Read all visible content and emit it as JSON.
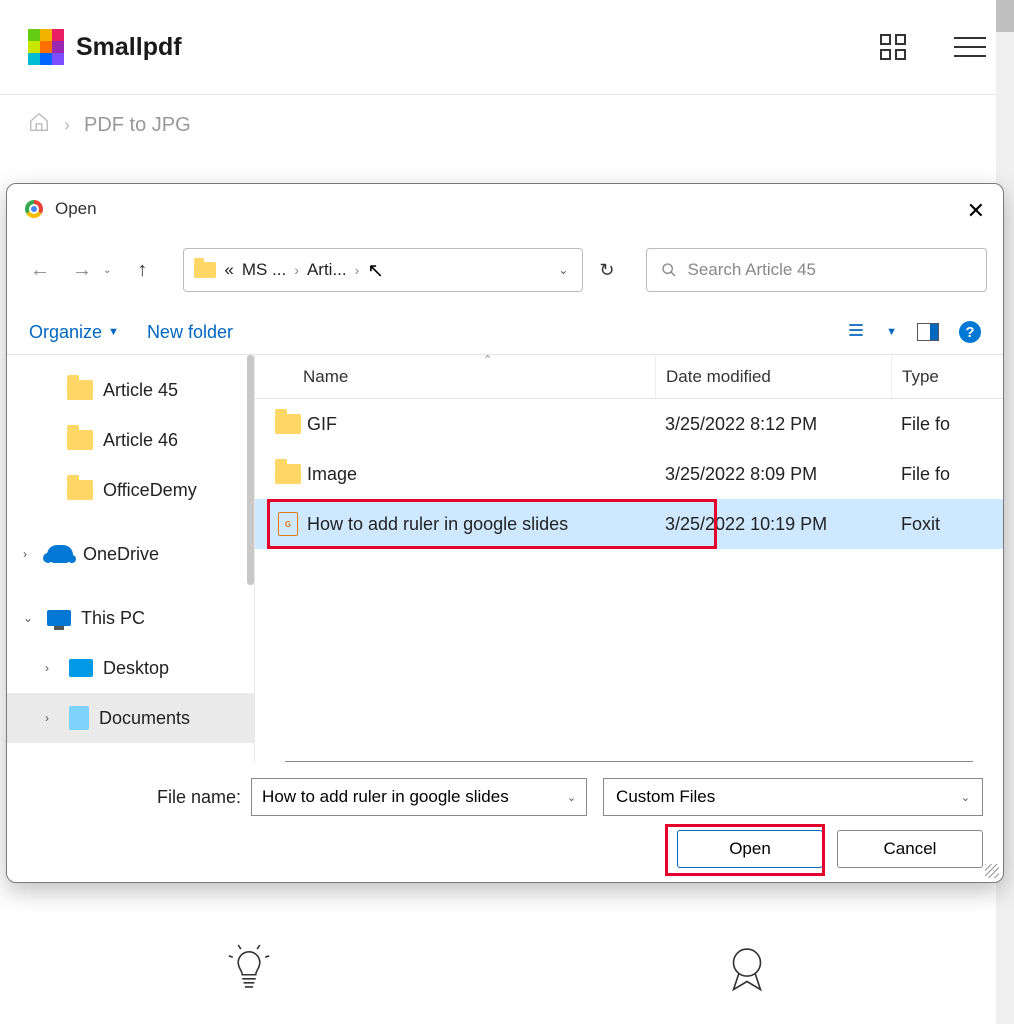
{
  "app": {
    "brand": "Smallpdf"
  },
  "breadcrumb": {
    "page": "PDF to JPG"
  },
  "dialog": {
    "title": "Open",
    "address": {
      "prefix": "«",
      "part1": "MS ...",
      "part2": "Arti..."
    },
    "search_placeholder": "Search Article 45",
    "toolbar": {
      "organize": "Organize",
      "new_folder": "New folder"
    },
    "tree": [
      {
        "label": "Article 45"
      },
      {
        "label": "Article 46"
      },
      {
        "label": "OfficeDemy"
      },
      {
        "label": "OneDrive"
      },
      {
        "label": "This PC"
      },
      {
        "label": "Desktop"
      },
      {
        "label": "Documents"
      }
    ],
    "columns": {
      "name": "Name",
      "date": "Date modified",
      "type": "Type"
    },
    "files": [
      {
        "name": "GIF",
        "date": "3/25/2022 8:12 PM",
        "type": "File fo",
        "kind": "folder"
      },
      {
        "name": "Image",
        "date": "3/25/2022 8:09 PM",
        "type": "File fo",
        "kind": "folder"
      },
      {
        "name": "How to add ruler in google slides",
        "date": "3/25/2022 10:19 PM",
        "type": "Foxit",
        "kind": "pdf",
        "selected": true
      }
    ],
    "filename_label": "File name:",
    "filename_value": "How to add ruler in google slides",
    "filter": "Custom Files",
    "open_btn": "Open",
    "cancel_btn": "Cancel"
  }
}
